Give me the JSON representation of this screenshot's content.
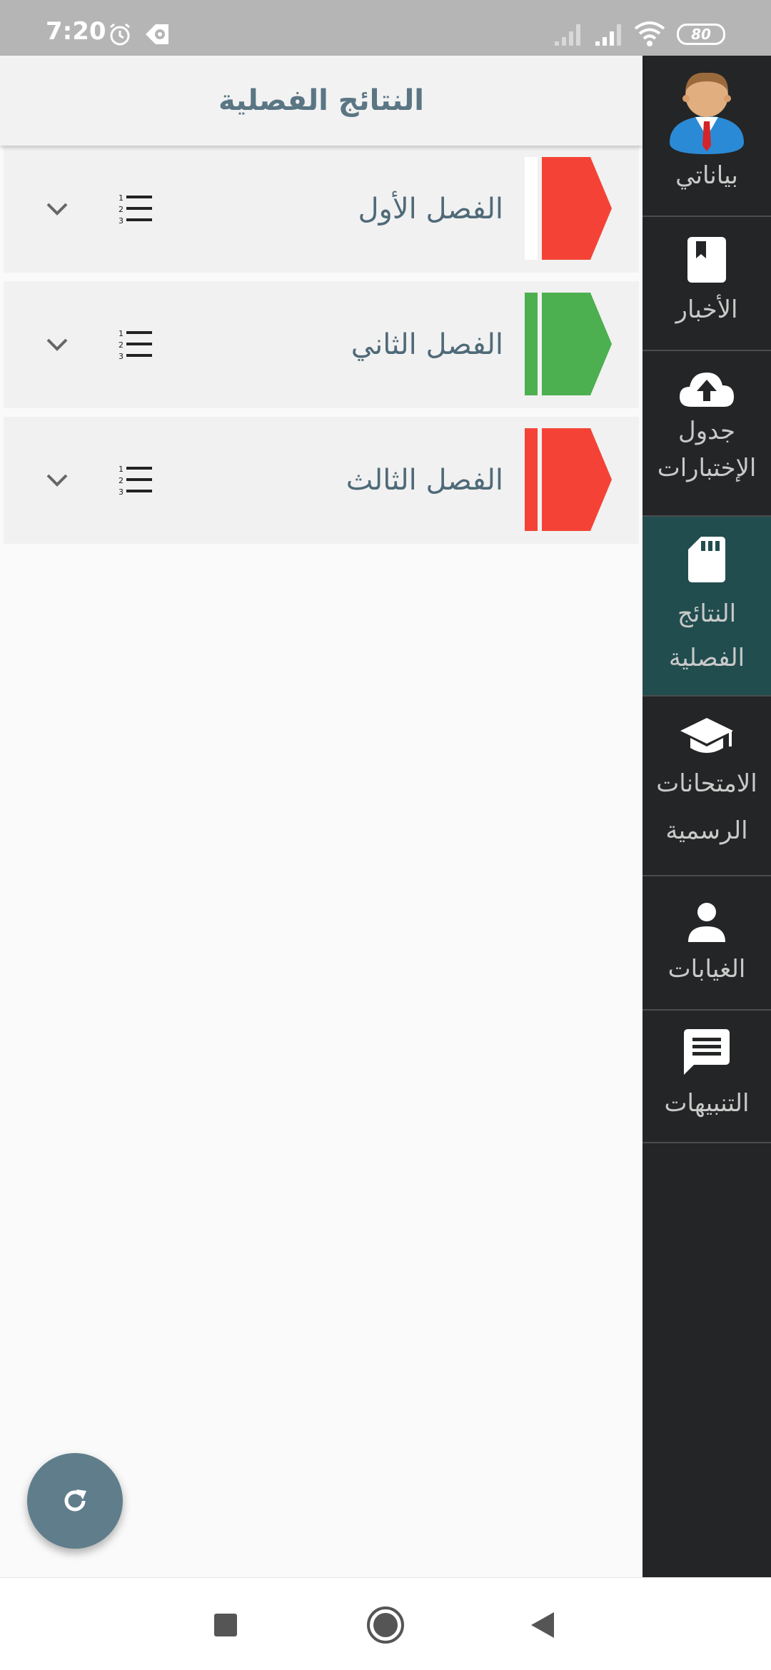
{
  "status_bar": {
    "time": "7:20",
    "battery": "80",
    "icons": [
      "alarm-icon",
      "app-notification-icon",
      "signal-icon",
      "signal-icon",
      "wifi-icon",
      "battery-icon"
    ]
  },
  "header": {
    "title": "النتائج الفصلية"
  },
  "terms": [
    {
      "label": "الفصل الأول",
      "color": "#f44336",
      "bar_color": "#ffffff",
      "icon": "numbered-list-icon"
    },
    {
      "label": "الفصل الثاني",
      "color": "#4caf50",
      "bar_color": "#4caf50",
      "icon": "numbered-list-icon"
    },
    {
      "label": "الفصل الثالث",
      "color": "#f44336",
      "bar_color": "#f44336",
      "icon": "numbered-list-icon"
    }
  ],
  "sidebar": {
    "items": [
      {
        "label": "بياناتي",
        "icon": "user-avatar-icon"
      },
      {
        "label": "الأخبار",
        "icon": "book-icon"
      },
      {
        "label_line1": "جدول",
        "label_line2": "الإختبارات",
        "icon": "cloud-upload-icon"
      },
      {
        "label_line1": "النتائج",
        "label_line2": "الفصلية",
        "icon": "sd-card-icon",
        "active": true
      },
      {
        "label_line1": "الامتحانات",
        "label_line2": "الرسمية",
        "icon": "graduation-cap-icon"
      },
      {
        "label": "الغيابات",
        "icon": "person-icon"
      },
      {
        "label": "التنبيهات",
        "icon": "message-icon"
      }
    ]
  },
  "fab": {
    "icon": "refresh-icon"
  },
  "nav_bar": {
    "icons": [
      "recents-icon",
      "home-icon",
      "back-icon"
    ]
  },
  "colors": {
    "sidebar_bg": "#242526",
    "sidebar_active": "#224d4f",
    "header_text": "#5a7684",
    "fab": "#607d8b",
    "red": "#f44336",
    "green": "#4caf50"
  }
}
